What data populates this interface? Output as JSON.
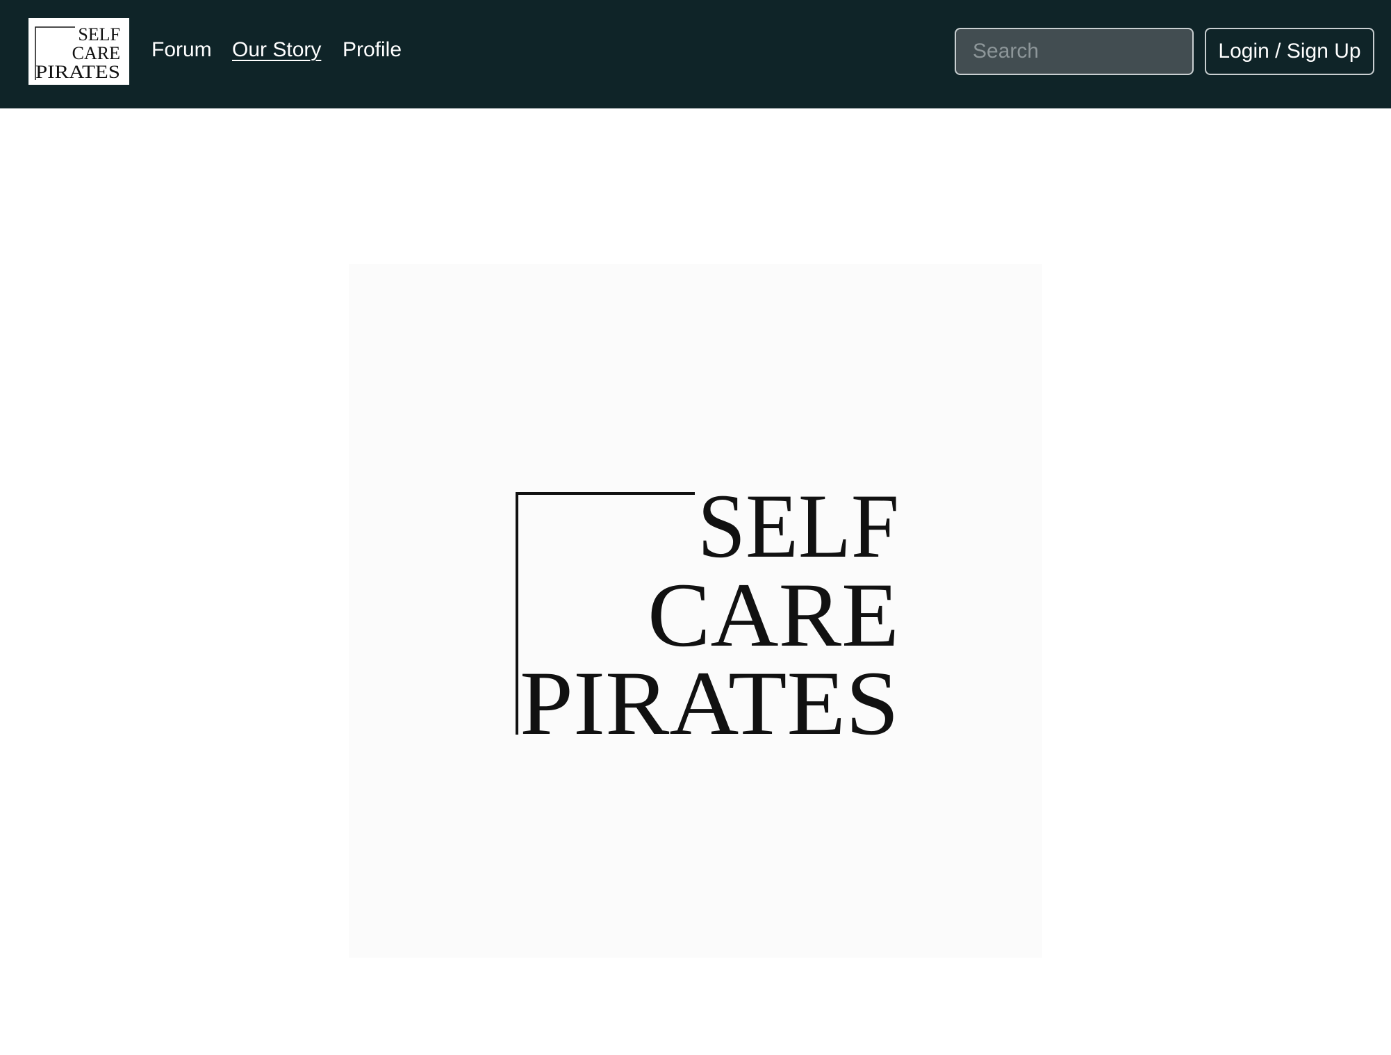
{
  "nav": {
    "brand_logo_text": [
      "SELF",
      "CARE",
      "PIRATES"
    ],
    "links": [
      {
        "label": "Forum",
        "active": false
      },
      {
        "label": "Our Story",
        "active": true
      },
      {
        "label": "Profile",
        "active": false
      }
    ],
    "search_placeholder": "Search",
    "search_value": "",
    "login_label": "Login / Sign Up"
  },
  "hero": {
    "logo_text": [
      "SELF",
      "CARE",
      "PIRATES"
    ]
  },
  "colors": {
    "navbar_bg": "#0f2428",
    "search_bg": "#424d51",
    "border": "#c9cfd1",
    "text_light": "#ffffff",
    "logo_ink": "#111111"
  }
}
